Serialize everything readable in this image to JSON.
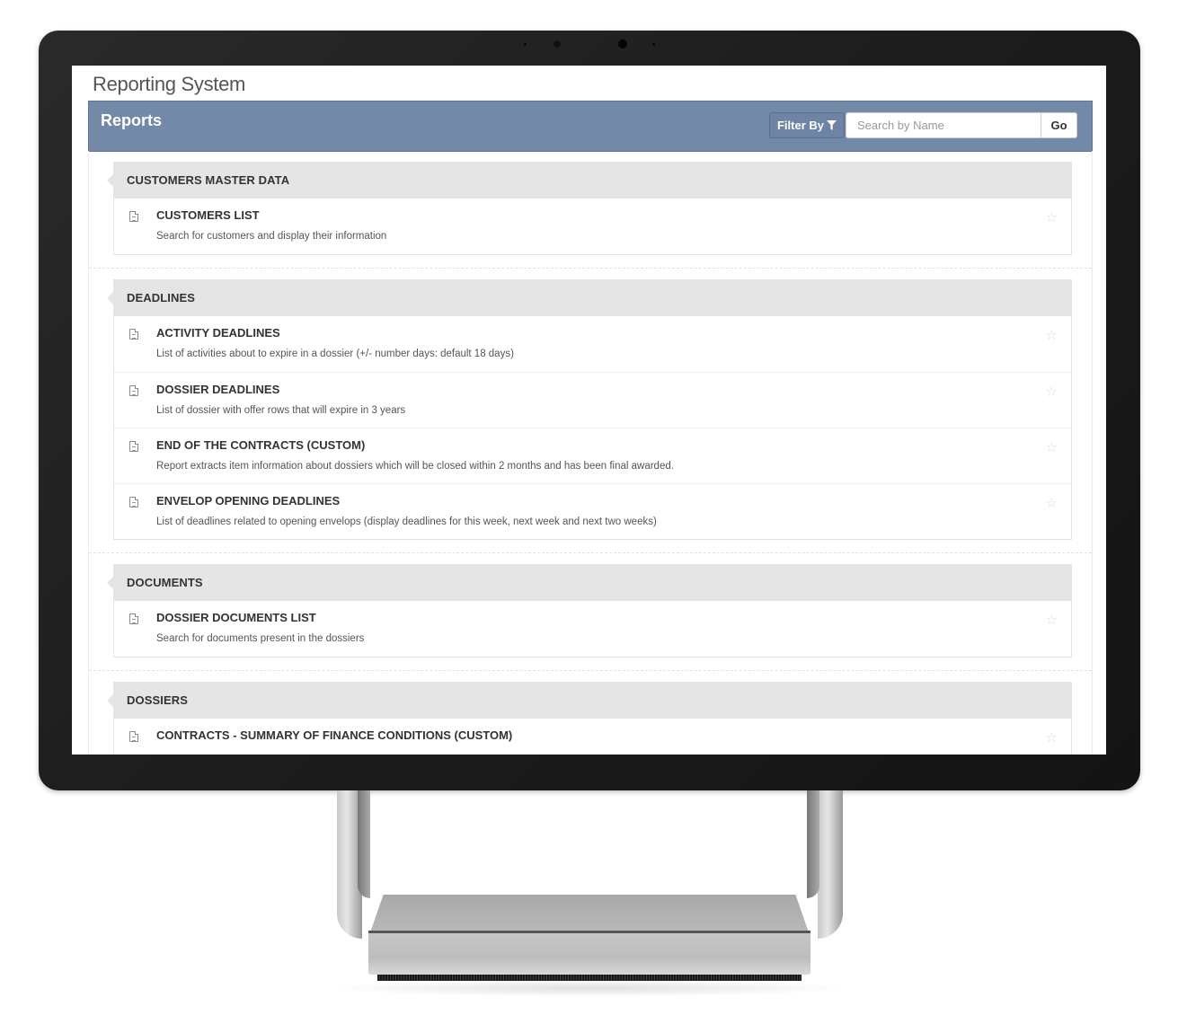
{
  "app": {
    "title": "Reporting System"
  },
  "header": {
    "title": "Reports",
    "filter_label": "Filter By",
    "filter_icon": "funnel-icon",
    "search_placeholder": "Search by Name",
    "search_value": "",
    "go_label": "Go"
  },
  "colors": {
    "header_bg": "#7389a8",
    "group_header_bg": "#e5e5e5"
  },
  "groups": [
    {
      "title": "CUSTOMERS MASTER DATA",
      "reports": [
        {
          "title": "CUSTOMERS LIST",
          "description": "Search for customers and display their information"
        }
      ]
    },
    {
      "title": "DEADLINES",
      "reports": [
        {
          "title": "ACTIVITY DEADLINES",
          "description": "List of activities about to expire in a dossier (+/- number days: default 18 days)"
        },
        {
          "title": "DOSSIER DEADLINES",
          "description": "List of dossier with offer rows that will expire in 3 years"
        },
        {
          "title": "END OF THE CONTRACTS (CUSTOM)",
          "description": "Report extracts item information about dossiers which will be closed within 2 months and has been final awarded."
        },
        {
          "title": "ENVELOP OPENING DEADLINES",
          "description": "List of deadlines related to opening envelops (display deadlines for this week, next week and next two weeks)"
        }
      ]
    },
    {
      "title": "DOCUMENTS",
      "reports": [
        {
          "title": "DOSSIER DOCUMENTS LIST",
          "description": "Search for documents present in the dossiers"
        }
      ]
    },
    {
      "title": "DOSSIERS",
      "reports": [
        {
          "title": "CONTRACTS - SUMMARY OF FINANCE CONDITIONS (CUSTOM)",
          "description": ""
        }
      ]
    }
  ],
  "icons": {
    "report": "document-icon",
    "favorite": "star-outline-icon",
    "star_glyph": "☆"
  }
}
